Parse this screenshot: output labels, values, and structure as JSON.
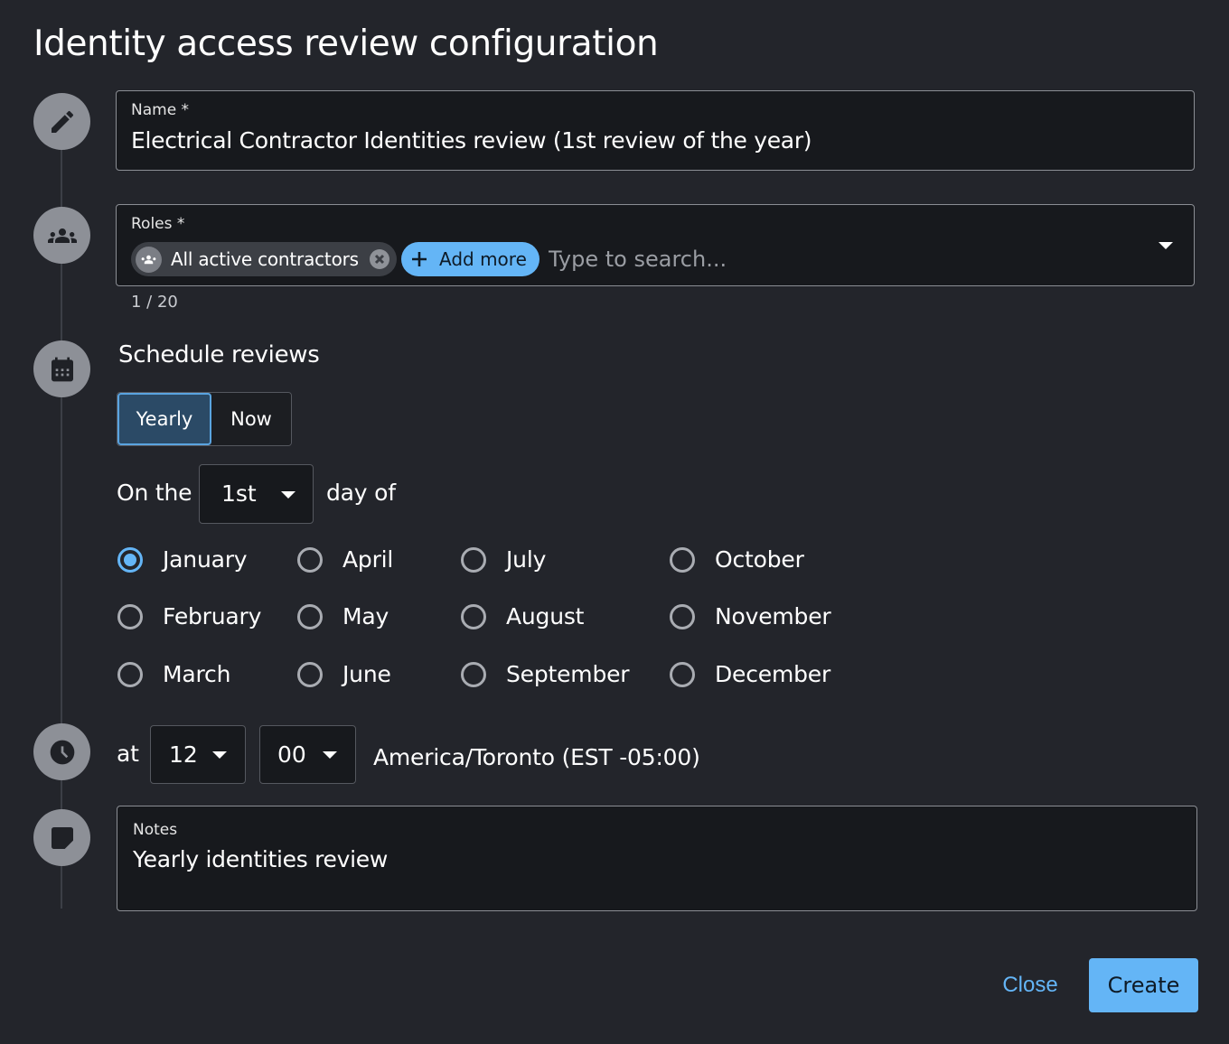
{
  "dialog": {
    "title": "Identity access review configuration"
  },
  "icons": {
    "step1": "pencil-icon",
    "step2": "group-icon",
    "step3": "calendar-icon",
    "step4": "clock-icon",
    "step5": "note-icon"
  },
  "name_field": {
    "label": "Name *",
    "value": "Electrical Contractor Identities review (1st review of the year)"
  },
  "roles_field": {
    "label": "Roles *",
    "chip_label": "All active contractors",
    "add_more_label": "Add more",
    "search_placeholder": "Type to search...",
    "helper": "1 / 20"
  },
  "schedule": {
    "heading": "Schedule reviews",
    "toggle": {
      "yearly": "Yearly",
      "now": "Now",
      "selected": "Yearly"
    },
    "prefix": "On the",
    "day_value": "1st",
    "suffix": "day of",
    "months": [
      {
        "label": "January",
        "checked": true
      },
      {
        "label": "February",
        "checked": false
      },
      {
        "label": "March",
        "checked": false
      },
      {
        "label": "April",
        "checked": false
      },
      {
        "label": "May",
        "checked": false
      },
      {
        "label": "June",
        "checked": false
      },
      {
        "label": "July",
        "checked": false
      },
      {
        "label": "August",
        "checked": false
      },
      {
        "label": "September",
        "checked": false
      },
      {
        "label": "October",
        "checked": false
      },
      {
        "label": "November",
        "checked": false
      },
      {
        "label": "December",
        "checked": false
      }
    ]
  },
  "time": {
    "prefix": "at",
    "hour": "12",
    "minute": "00",
    "timezone": "America/Toronto (EST -05:00)"
  },
  "notes_field": {
    "label": "Notes",
    "value": "Yearly identities review"
  },
  "actions": {
    "close_label": "Close",
    "create_label": "Create"
  },
  "colors": {
    "background": "#23252b",
    "field_background": "#17191d",
    "accent": "#64b5f6",
    "step_icon_background": "#8d9097"
  }
}
